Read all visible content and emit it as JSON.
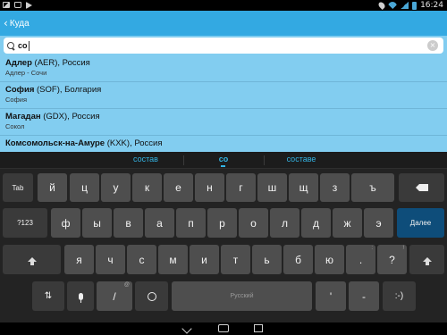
{
  "statusbar": {
    "time": "16:24",
    "left_icons": [
      "image-icon",
      "bag-icon",
      "play-store-icon"
    ],
    "right_icons": [
      "location-icon",
      "wifi-icon",
      "signal-icon",
      "battery-icon"
    ]
  },
  "actionbar": {
    "back_chevron": "‹",
    "title": "Куда"
  },
  "search": {
    "value": "со",
    "clear_glyph": "×"
  },
  "results": [
    {
      "city": "Адлер",
      "code": " (AER)",
      "country": ", Россия",
      "sub": "Адлер - Сочи"
    },
    {
      "city": "София",
      "code": " (SOF)",
      "country": ", Болгария",
      "sub": "София"
    },
    {
      "city": "Магадан",
      "code": " (GDX)",
      "country": ", Россия",
      "sub": "Сокол"
    },
    {
      "city": "Комсомольск-на-Амуре",
      "code": " (KXK)",
      "country": ", Россия",
      "sub": ""
    }
  ],
  "keyboard": {
    "suggestions": [
      "состав",
      "со",
      "составе"
    ],
    "row1": {
      "tab": "Tab",
      "keys": [
        "й",
        "ц",
        "у",
        "к",
        "е",
        "н",
        "г",
        "ш",
        "щ",
        "з",
        "ъ"
      ]
    },
    "row2": {
      "num": "?123",
      "keys": [
        "ф",
        "ы",
        "в",
        "а",
        "п",
        "р",
        "о",
        "л",
        "д",
        "ж",
        "э"
      ],
      "action": "Далее"
    },
    "row3": {
      "keys": [
        "я",
        "ч",
        "с",
        "м",
        "и",
        "т",
        "ь",
        "б",
        "ю",
        ".",
        "?"
      ],
      "hints": [
        "",
        "",
        "",
        "",
        "",
        "",
        "",
        "",
        "",
        ":",
        "!"
      ]
    },
    "row4": {
      "slash": "/",
      "slash_hint": "@",
      "space_label": "Русский",
      "apostrophe": "'",
      "minus": "-",
      "smiley": ":-)"
    },
    "colors": {
      "suggestion": "#33b5e5",
      "action_key": "#0e4d7a"
    }
  }
}
